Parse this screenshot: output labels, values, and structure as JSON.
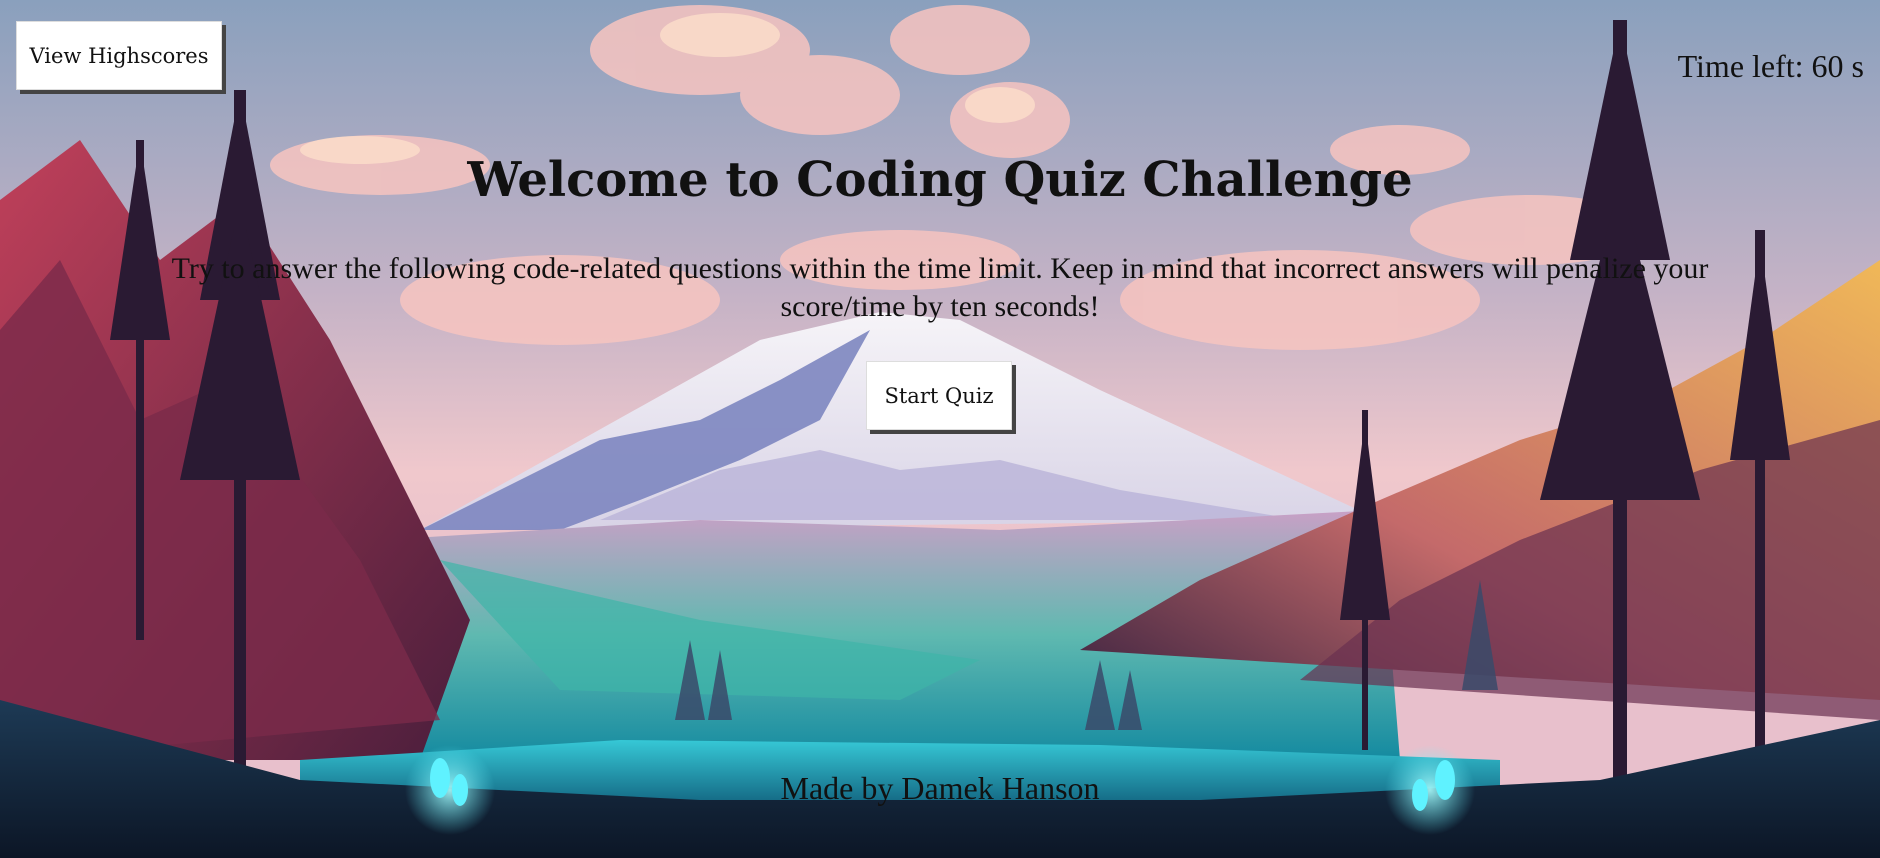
{
  "header": {
    "highscores_label": "View Highscores",
    "timer_text": "Time left: 60 s"
  },
  "main": {
    "title": "Welcome to Coding Quiz Challenge",
    "intro": "Try to answer the following code-related questions within the time limit. Keep in mind that incorrect answers will penalize your score/time by ten seconds!",
    "start_label": "Start Quiz"
  },
  "footer": {
    "credit": "Made by Damek Hanson"
  },
  "colors": {
    "sky_top": "#8aa0bd",
    "cloud_pink": "#f7c2c0",
    "mountain_snow": "#f2f0f6",
    "mountain_shadow": "#7d86c0",
    "forest_left": "#b0405a",
    "hillside_gold": "#e0a050",
    "lake_teal": "#1fa6b8",
    "dark_tree": "#2a1a33",
    "glow_cyan": "#5ff2ff"
  }
}
